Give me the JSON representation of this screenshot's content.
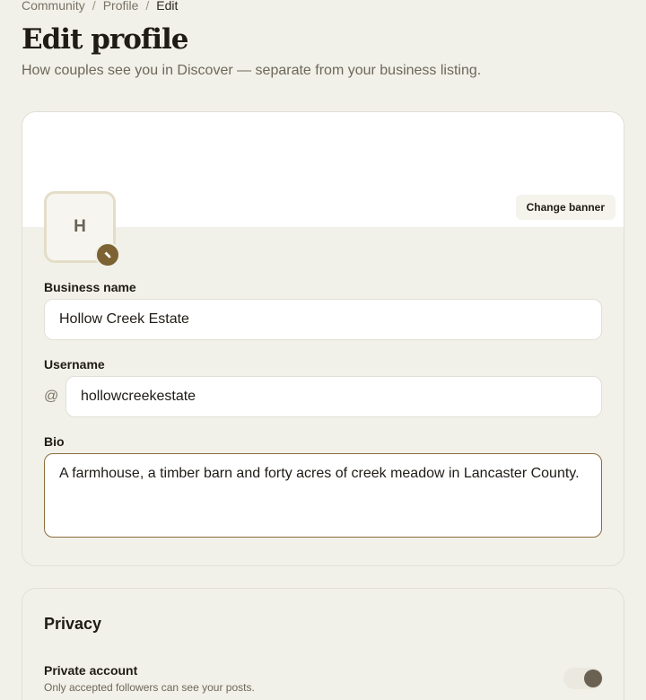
{
  "breadcrumb": {
    "items": [
      "Community",
      "Profile"
    ],
    "separator": "/",
    "current": "Edit"
  },
  "header": {
    "title": "Edit profile",
    "subtitle": "How couples see you in Discover — separate from your business listing."
  },
  "profile": {
    "change_banner_label": "Change banner",
    "avatar_initial": "H",
    "business_name_label": "Business name",
    "business_name_value": "Hollow Creek Estate",
    "username_label": "Username",
    "username_prefix": "@",
    "username_value": "hollowcreekestate",
    "bio_label": "Bio",
    "bio_value": "A farmhouse, a timber barn and forty acres of creek meadow in Lancaster County."
  },
  "privacy": {
    "title": "Privacy",
    "private_account_label": "Private account",
    "private_account_desc": "Only accepted followers can see your posts.",
    "private_account_on": true
  },
  "colors": {
    "accent": "#7d6233",
    "background": "#f1f1e9",
    "toggle_knob": "#6b6152"
  },
  "icons": {
    "avatar_edit": "pencil-icon"
  }
}
